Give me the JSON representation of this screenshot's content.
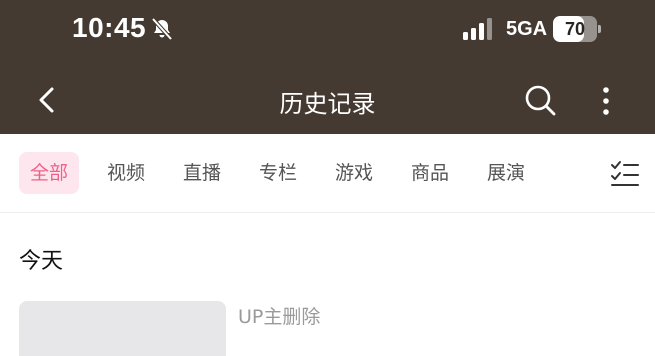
{
  "status_bar": {
    "time": "10:45",
    "network": "5GA",
    "battery": "70",
    "battery_level": 0.7,
    "icons": [
      "bell-mute-icon",
      "signal-icon",
      "battery-icon"
    ]
  },
  "header": {
    "title": "历史记录",
    "icons": [
      "back-arrow-icon",
      "search-icon",
      "more-vertical-icon"
    ],
    "background": "#443a32"
  },
  "tabs": {
    "items": [
      {
        "label": "全部",
        "active": true
      },
      {
        "label": "视频",
        "active": false
      },
      {
        "label": "直播",
        "active": false
      },
      {
        "label": "专栏",
        "active": false
      },
      {
        "label": "游戏",
        "active": false
      },
      {
        "label": "商品",
        "active": false
      },
      {
        "label": "展演",
        "active": false
      }
    ],
    "accent": "#f0608a",
    "accent_bg": "#fde6ed",
    "filter_icon": "list-filter-icon"
  },
  "main": {
    "section_title": "今天",
    "items": [
      {
        "text": "UP主删除"
      }
    ]
  }
}
